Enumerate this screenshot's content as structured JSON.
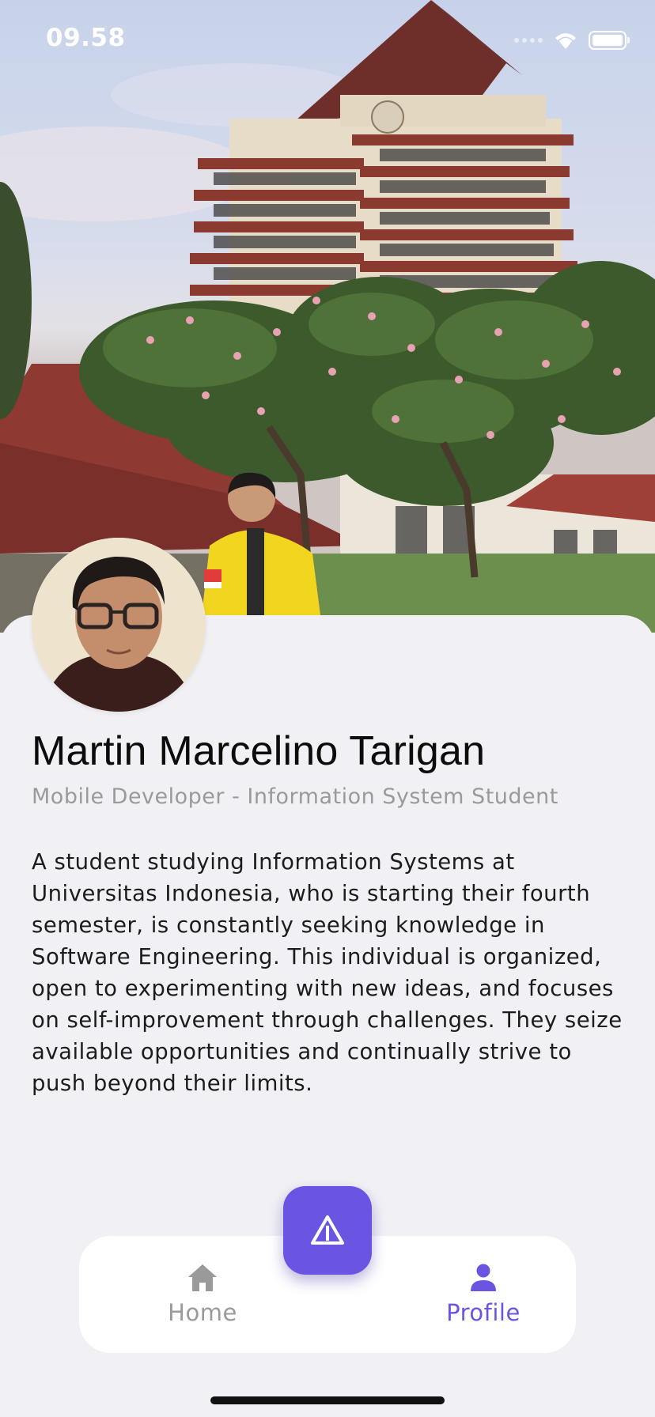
{
  "status_bar": {
    "time": "09.58"
  },
  "profile": {
    "name": "Martin Marcelino Tarigan",
    "role": "Mobile Developer - Information System Student",
    "bio": "A student studying Information Systems at Universitas Indonesia, who is starting their fourth semester, is constantly seeking knowledge in Software Engineering. This individual is organized, open to experimenting with new ideas, and focuses on self-improvement through challenges. They seize available opportunities and continually strive to push beyond their limits."
  },
  "bottom_nav": {
    "items": [
      {
        "label": "Home",
        "icon": "home-icon",
        "active": false
      },
      {
        "label": "Profile",
        "icon": "person-icon",
        "active": true
      }
    ],
    "center_button_icon": "warning-triangle-icon"
  },
  "colors": {
    "accent": "#6a55e3",
    "background": "#f1f1f5",
    "inactive": "#9a9a9a"
  }
}
